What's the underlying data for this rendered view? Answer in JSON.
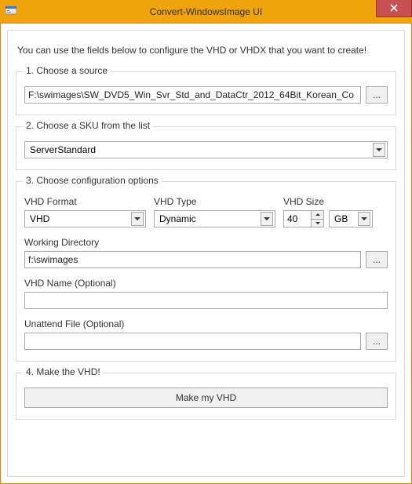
{
  "window": {
    "title": "Convert-WindowsImage UI",
    "intro": "You can use the fields below to configure the VHD or VHDX that you want to create!"
  },
  "group1": {
    "legend": "1. Choose a source",
    "source_path": "F:\\swimages\\SW_DVD5_Win_Svr_Std_and_DataCtr_2012_64Bit_Korean_Co",
    "browse_label": "..."
  },
  "group2": {
    "legend": "2. Choose a SKU from the list",
    "sku_selected": "ServerStandard"
  },
  "group3": {
    "legend": "3. Choose configuration options",
    "format_label": "VHD Format",
    "format_value": "VHD",
    "type_label": "VHD Type",
    "type_value": "Dynamic",
    "size_label": "VHD Size",
    "size_value": "40",
    "size_unit": "GB",
    "workdir_label": "Working Directory",
    "workdir_value": "f:\\swimages",
    "workdir_browse": "...",
    "vhdname_label": "VHD Name (Optional)",
    "vhdname_value": "",
    "unattend_label": "Unattend File (Optional)",
    "unattend_value": "",
    "unattend_browse": "..."
  },
  "group4": {
    "legend": "4. Make the VHD!",
    "make_button": "Make my VHD"
  }
}
